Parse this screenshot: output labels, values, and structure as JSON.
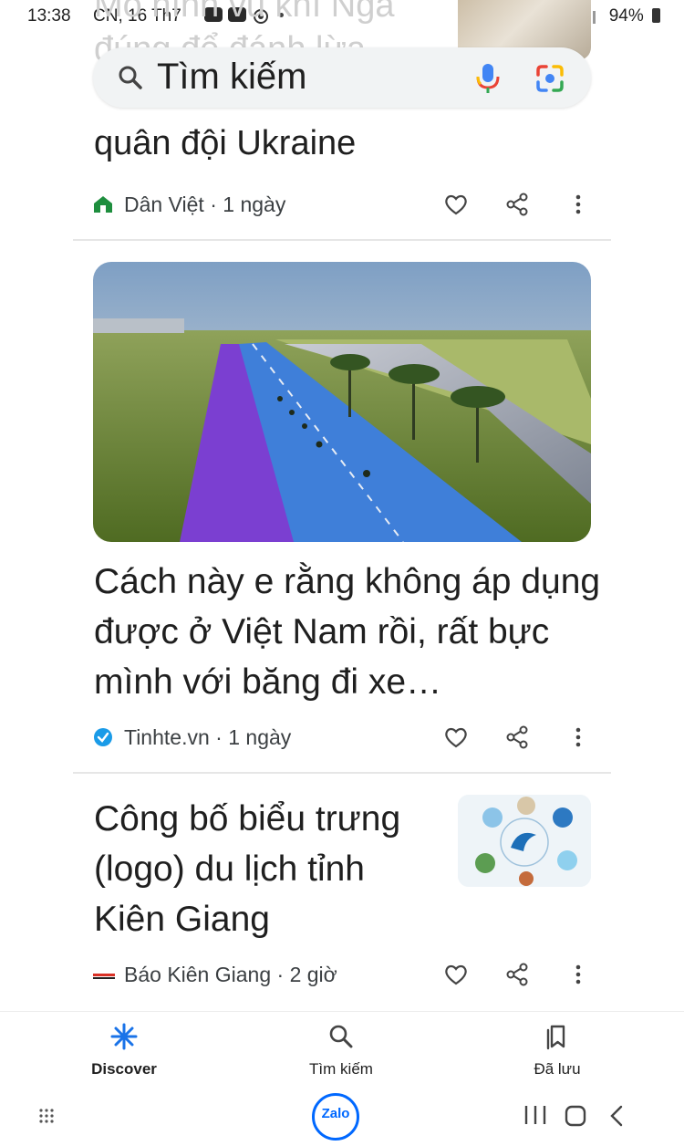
{
  "status_bar": {
    "time": "13:38",
    "date": "CN, 16 Th7",
    "battery": "94%"
  },
  "search": {
    "placeholder": "Tìm kiếm"
  },
  "top_article_ghost": {
    "title_fragment": "Mô hình vũ khí Nga\nđúng để đánh lừa"
  },
  "articles": [
    {
      "title": "quân đội Ukraine",
      "source": "Dân Việt",
      "age": "1 ngày"
    },
    {
      "title": "Cách này e rằng không áp dụng được ở Việt Nam rồi, rất bực mình với băng đi xe…",
      "source": "Tinhte.vn",
      "age": "1 ngày"
    },
    {
      "title": "Công bố biểu trưng (logo) du lịch tỉnh Kiên Giang",
      "source": "Báo Kiên Giang",
      "age": "2 giờ"
    }
  ],
  "meta_separator": "·",
  "bottom_nav": {
    "discover": "Discover",
    "search": "Tìm kiếm",
    "saved": "Đã lưu"
  },
  "system_bar": {
    "app_label": "Zalo"
  },
  "colors": {
    "accent_blue": "#1a73e8",
    "text": "#1f1f1f",
    "meta_text": "#3c4043"
  }
}
